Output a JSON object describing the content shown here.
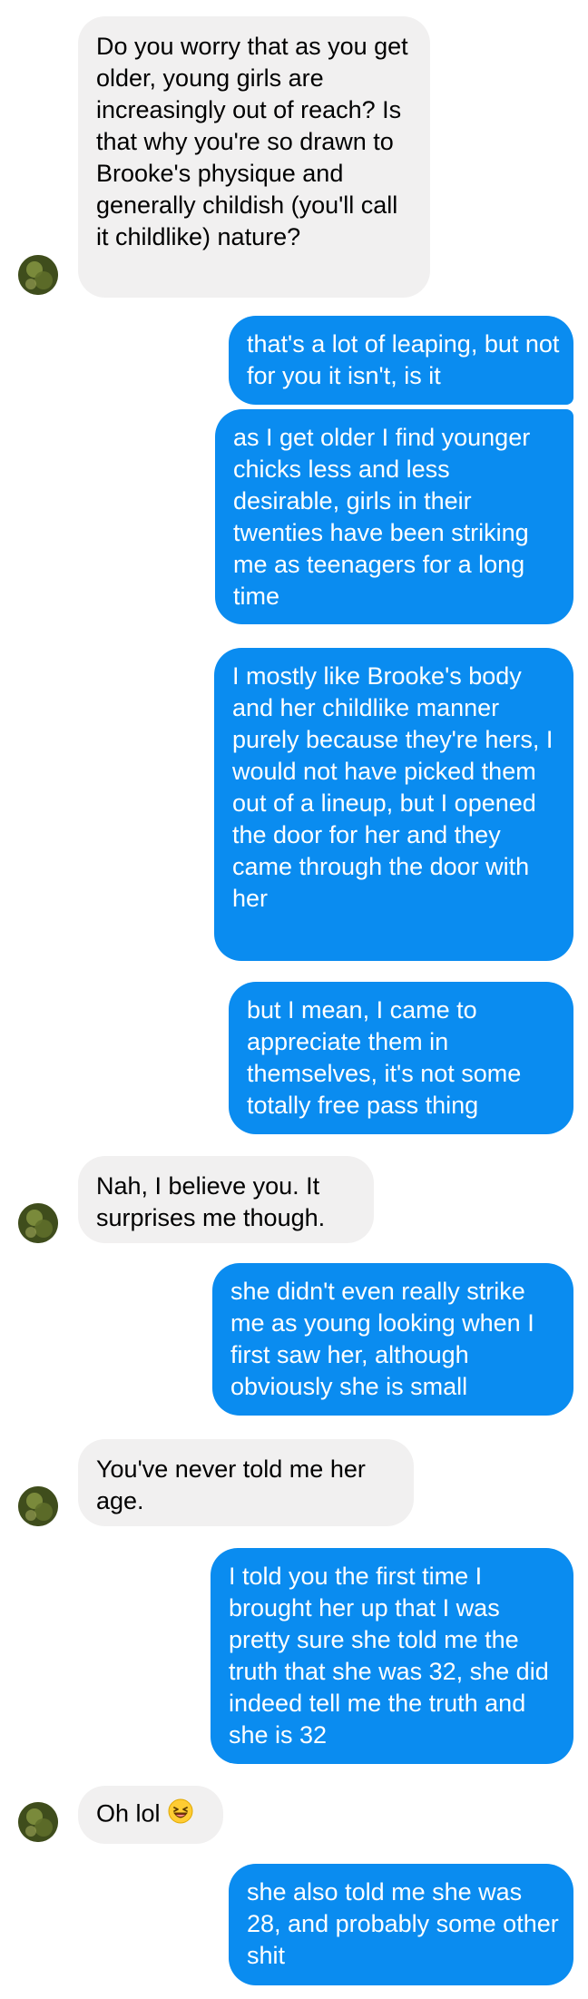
{
  "conversation": {
    "messages": [
      {
        "from": "them",
        "text": "Do you worry that as you get older, young girls are increasingly out of reach? Is that why you're so drawn to Brooke's physique and generally childish (you'll call it childlike) nature?"
      },
      {
        "from": "me",
        "text": "that's a lot of leaping, but not for you it isn't, is it"
      },
      {
        "from": "me",
        "text": "as I get older I find younger chicks less and less desirable, girls in their twenties have been striking me as teenagers for a long time"
      },
      {
        "from": "me",
        "text": "I mostly like Brooke's body and her childlike manner purely because they're hers, I would not have picked them out of a lineup, but I opened the door for her and they came through the door with her"
      },
      {
        "from": "me",
        "text": "but I mean, I came to appreciate them in themselves, it's not some totally free pass thing"
      },
      {
        "from": "them",
        "text": "Nah, I believe you. It surprises me though."
      },
      {
        "from": "me",
        "text": "she didn't even really strike me as young looking when I first saw her, although obviously she is small"
      },
      {
        "from": "them",
        "text": "You've never told me her age."
      },
      {
        "from": "me",
        "text": "I told you the first time I brought her up that I was pretty sure she told me the truth that she was 32, she did indeed tell me the truth and she is 32"
      },
      {
        "from": "them",
        "text": "Oh lol",
        "emoji": "laughing-face"
      },
      {
        "from": "me",
        "text": "she also told me she was 28, and probably some other shit"
      }
    ]
  },
  "colors": {
    "incoming_bubble": "#f1f0f0",
    "outgoing_bubble": "#0a8cf0",
    "incoming_text": "#000000",
    "outgoing_text": "#ffffff"
  }
}
